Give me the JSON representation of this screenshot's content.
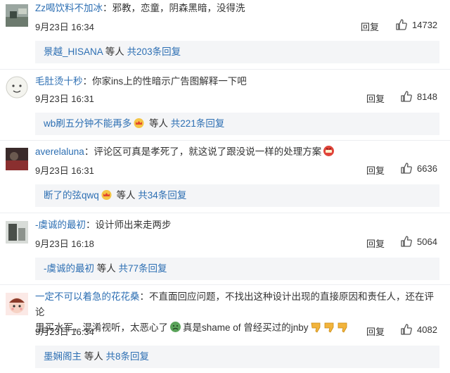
{
  "labels": {
    "reply": "回复",
    "like_icon": "thumbs-up-icon"
  },
  "comments": [
    {
      "user": "Zz喝饮料不加冰",
      "sep": "：",
      "text": "邪教，恋童，阴森黑暗，没得洗",
      "time": "9月23日 16:34",
      "likes": "14732",
      "sub": {
        "user": "景越_HISANA",
        "others": "等人",
        "count": "共203条回复"
      }
    },
    {
      "user": "毛肚烫十秒",
      "sep": "：",
      "text": "你家ins上的性暗示广告图解释一下吧",
      "time": "9月23日 16:31",
      "likes": "8148",
      "sub": {
        "user": "wb刷五分钟不能再多",
        "others": "等人",
        "count": "共221条回复"
      }
    },
    {
      "user": "averelaluna",
      "sep": "：",
      "text": "评论区可真是孝死了，就这说了跟没说一样的处理方案",
      "time": "9月23日 16:31",
      "likes": "6636",
      "sub": {
        "user": "断了的弦qwq",
        "others": "等人",
        "count": "共34条回复"
      }
    },
    {
      "user": "-虞诚的最初",
      "sep": "：",
      "text": "设计师出来走两步",
      "time": "9月23日 16:18",
      "likes": "5064",
      "sub": {
        "user": "-虞诚的最初",
        "others": "等人",
        "count": "共77条回复"
      }
    },
    {
      "user": "一定不可以着急的花花桑",
      "sep": "：",
      "text": "不直面回应问题，不找出这种设计出现的直接原因和责任人，还在评论",
      "text2a": "里买水军，混淆视听，太恶心了",
      "text2b": "真是shame of 曾经买过的jnby",
      "time": "9月23日 16:34",
      "likes": "4082",
      "sub": {
        "user": "墨娴阁主",
        "others": "等人",
        "count": "共8条回复"
      }
    }
  ]
}
